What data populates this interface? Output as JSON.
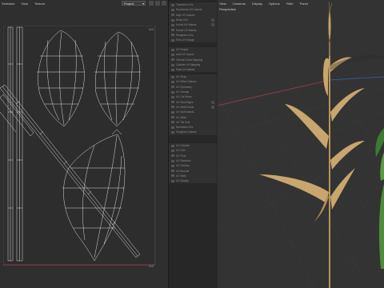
{
  "uv_editor": {
    "menu": [
      "Selection",
      "View",
      "Texture"
    ],
    "view_dropdown": "Project",
    "corner_top_label": "1.0",
    "corner_bottom_label": "1.0"
  },
  "tool_panel": {
    "groups": [
      {
        "items": [
          "Transform UVs",
          "Randomize UV Islands",
          "Align UV Islands",
          "Relax UVs",
          "Unfold UV Islands",
          "Rotate UV Islands",
          "Straighten UVs",
          "Fit to UV Range"
        ]
      },
      {
        "items": [
          "UV Project",
          "Auto UV Layout",
          "Optimal Cubic Mapping",
          "Cylinder UV Mapping",
          "Pack UV Islands"
        ]
      },
      {
        "items": [
          "UV Snap",
          "UV Relax Options",
          "UV Symmetry",
          "UV Unwrap",
          "UV Cut Seam",
          "UV Sew Edges",
          "UV Weld Points",
          "UV Split Islands",
          "UV Stitch",
          "UV Tile Grid",
          "Normalize UVs",
          "Straighten Islands"
        ]
      },
      {
        "items": [
          "UV Checker",
          "UV Grid",
          "UV Pivot",
          "UV Distortion",
          "UV Overlap",
          "UV Bounds",
          "UV Stats",
          "UV Display"
        ]
      }
    ]
  },
  "viewport": {
    "menu": [
      "View",
      "Cameras",
      "Display",
      "Options",
      "Filter",
      "Panel"
    ],
    "view_name": "Perspective"
  },
  "colors": {
    "accent_red": "#a8424a",
    "accent_blue": "#3c5fb0",
    "wheat_leaf": "#c9a66e",
    "green_plant": "#3f7a34"
  }
}
